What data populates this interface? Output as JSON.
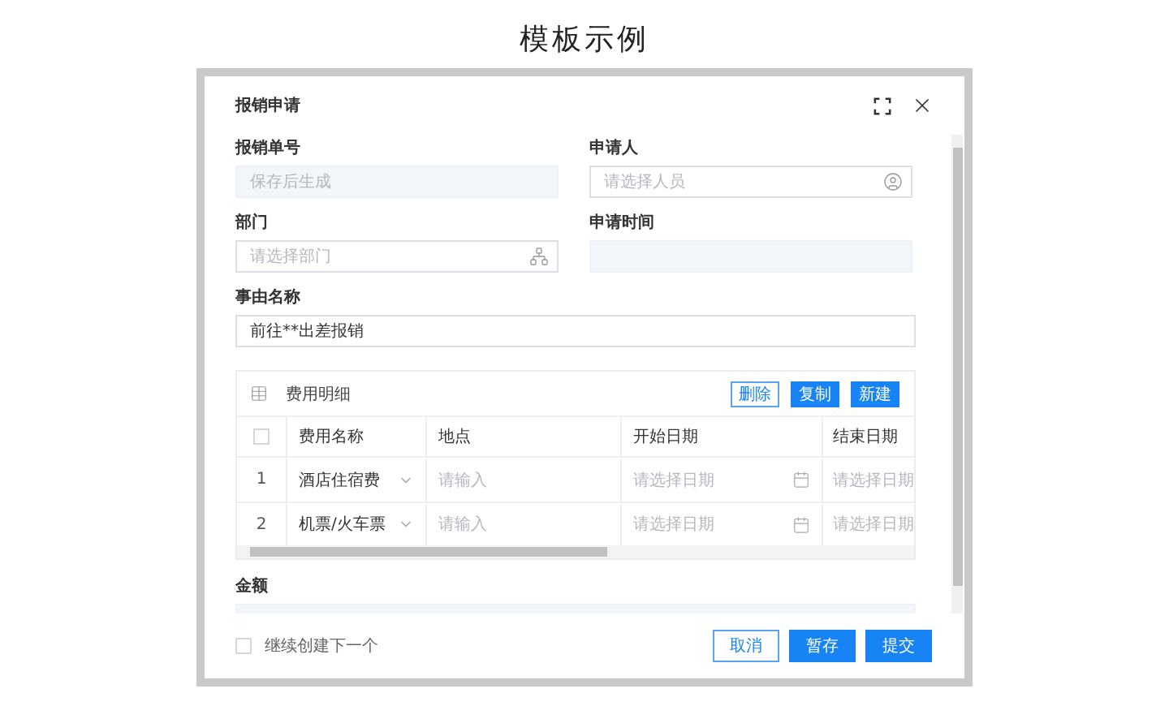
{
  "page_title": "模板示例",
  "dialog": {
    "title": "报销申请"
  },
  "fields": [
    {
      "kind": "text",
      "label": "报销单号",
      "placeholder": "保存后生成",
      "disabled": true
    },
    {
      "kind": "person",
      "label": "申请人",
      "placeholder": "请选择人员",
      "disabled": false
    },
    {
      "kind": "org",
      "label": "部门",
      "placeholder": "请选择部门",
      "disabled": false
    },
    {
      "kind": "text",
      "label": "申请时间",
      "disabled": true
    }
  ],
  "reason": {
    "label": "事由名称",
    "value": "前往**出差报销"
  },
  "expense": {
    "title": "费用明细",
    "buttons": [
      {
        "label": "删除",
        "kind": "outline"
      },
      {
        "label": "复制",
        "kind": "primary"
      },
      {
        "label": "新建",
        "kind": "primary"
      }
    ],
    "header_checked": false,
    "columns": [
      "费用名称",
      "地点",
      "开始日期",
      "结束日期"
    ],
    "rows": [
      {
        "index": "1",
        "name": "酒店住宿费",
        "place_placeholder": "请输入",
        "start_placeholder": "请选择日期",
        "end_placeholder": "请选择日期"
      },
      {
        "index": "2",
        "name": "机票/火车票",
        "place_placeholder": "请输入",
        "start_placeholder": "请选择日期",
        "end_placeholder": "请选择日期"
      }
    ]
  },
  "amount": {
    "label": "金额"
  },
  "footer": {
    "continue": {
      "label": "继续创建下一个",
      "checked": false
    },
    "buttons": [
      {
        "label": "取消",
        "kind": "outline"
      },
      {
        "label": "暂存",
        "kind": "primary"
      },
      {
        "label": "提交",
        "kind": "primary"
      }
    ]
  }
}
